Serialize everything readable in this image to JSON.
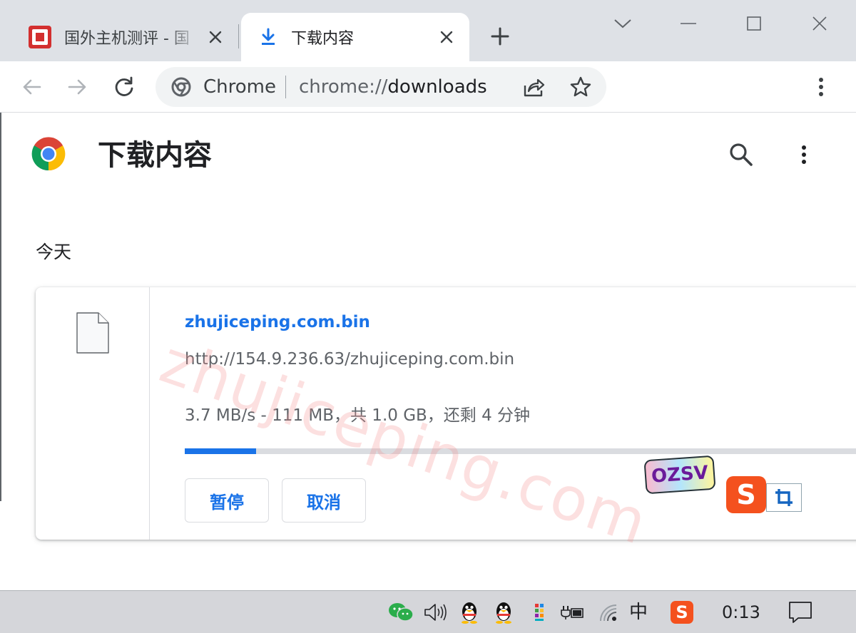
{
  "tabs": {
    "inactive_title": "国外主机测评 - 国",
    "active_title": "下载内容"
  },
  "toolbar": {
    "omnibox_label": "Chrome",
    "url_scheme": "chrome://",
    "url_path": "downloads"
  },
  "page": {
    "title": "下载内容",
    "date_heading": "今天",
    "watermark": "zhujiceping.com"
  },
  "download": {
    "file_name": "zhujiceping.com.bin",
    "url": "http://154.9.236.63/zhujiceping.com.bin",
    "status": "3.7 MB/s - 111 MB，共 1.0 GB，还剩 4 分钟",
    "progress_fraction": 0.104,
    "pause_label": "暂停",
    "cancel_label": "取消"
  },
  "overlays": {
    "sticker_text": "OZSV",
    "sogou_letter": "S"
  },
  "taskbar": {
    "ime_label": "中",
    "sogou_letter": "S",
    "clock": "0:13"
  },
  "colors": {
    "accent": "#1a73e8",
    "tab_strip": "#dee1e6",
    "omnibox": "#f1f3f4",
    "sogou": "#f4511e"
  },
  "icons": {
    "site_favicon": "site-favicon-icon",
    "download_tab": "download-icon",
    "back": "arrow-left-icon",
    "forward": "arrow-right-icon",
    "reload": "reload-icon",
    "chrome": "chrome-logo-icon",
    "share": "share-icon",
    "bookmark": "star-icon",
    "menu": "more-vert-icon",
    "search": "search-icon",
    "file": "file-icon"
  }
}
